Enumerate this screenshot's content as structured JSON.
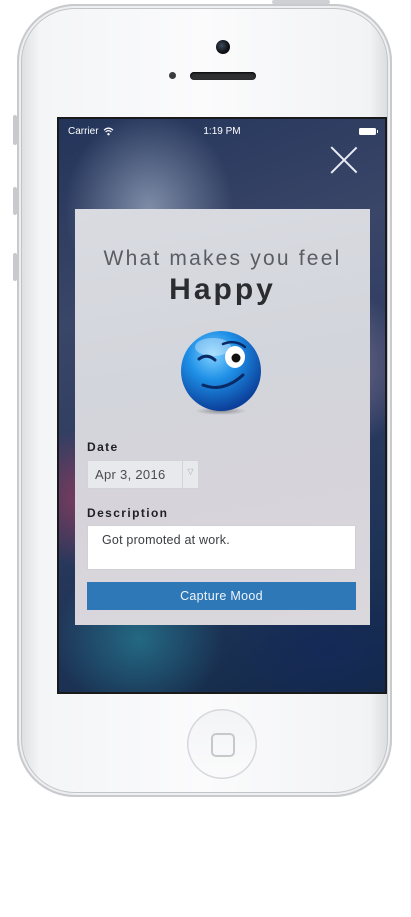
{
  "status_bar": {
    "carrier": "Carrier",
    "time": "1:19 PM"
  },
  "card": {
    "heading": "What makes you feel",
    "mood": "Happy",
    "emoji": "winking-blue-smiley",
    "date_label": "Date",
    "date_value": "Apr 3, 2016",
    "description_label": "Description",
    "description_value": "Got promoted at work.",
    "capture_button": "Capture Mood"
  },
  "colors": {
    "accent": "#2f78b7",
    "card_background": "#d6d8de",
    "text_dark": "#2b2c30"
  }
}
